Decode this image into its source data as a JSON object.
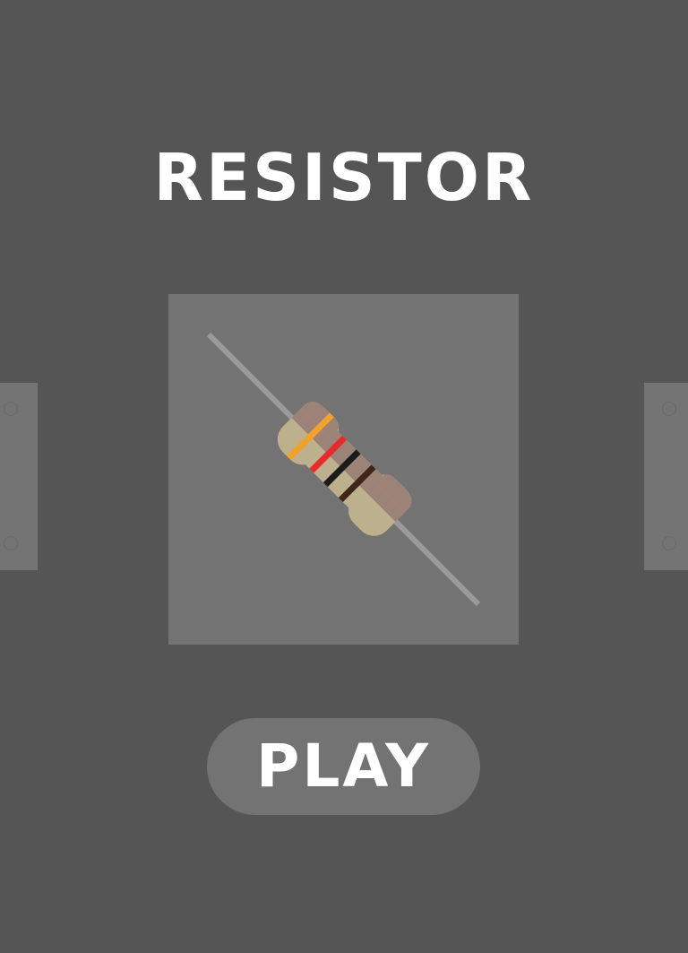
{
  "game": {
    "title": "RESISTOR",
    "play_label": "PLAY"
  },
  "icons": {
    "main": "resistor-icon",
    "left_tab": "side-tab",
    "right_tab": "side-tab"
  },
  "resistor": {
    "band_colors": [
      "#f2a12b",
      "#e82a2a",
      "#1c1b1b",
      "#3e2619"
    ],
    "body_colors": [
      "#bdb08d",
      "#9c8378"
    ],
    "lead_color": "#9a9a9a"
  },
  "colors": {
    "background": "#555555",
    "panel": "#737373",
    "text": "#ffffff"
  }
}
